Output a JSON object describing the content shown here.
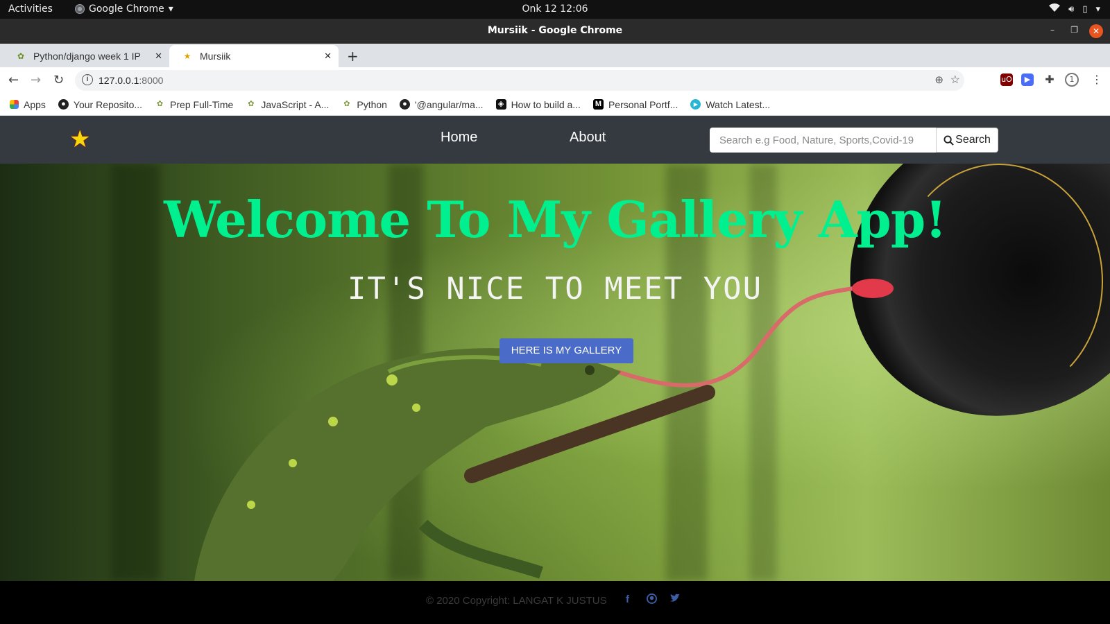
{
  "system": {
    "activities": "Activities",
    "app_name": "Google Chrome",
    "clock": "Onk 12  12:06"
  },
  "window": {
    "title": "Mursiik - Google Chrome"
  },
  "tabs": [
    {
      "label": "Python/django week 1 IP",
      "active": false
    },
    {
      "label": "Mursiik",
      "active": true
    }
  ],
  "address": {
    "host": "127.0.0.1",
    "port": ":8000"
  },
  "bookmarks": [
    {
      "label": "Apps",
      "icon": "apps-grid-icon"
    },
    {
      "label": "Your Reposito...",
      "icon": "github-icon"
    },
    {
      "label": "Prep Full-Time",
      "icon": "leaf-icon"
    },
    {
      "label": "JavaScript - A...",
      "icon": "leaf-icon"
    },
    {
      "label": "Python",
      "icon": "leaf-icon"
    },
    {
      "label": "'@angular/ma...",
      "icon": "github-icon"
    },
    {
      "label": "How to build a...",
      "icon": "dark-icon"
    },
    {
      "label": "Personal Portf...",
      "icon": "medium-icon"
    },
    {
      "label": "Watch Latest...",
      "icon": "play-icon"
    }
  ],
  "site": {
    "nav": {
      "home": "Home",
      "about": "About"
    },
    "search": {
      "placeholder": "Search e.g Food, Nature, Sports,Covid-19",
      "button": "Search"
    },
    "hero": {
      "heading": "Welcome To My Gallery App!",
      "subheading": "IT'S NICE TO MEET YOU",
      "button": "HERE IS MY GALLERY"
    },
    "footer": {
      "copyright": "© 2020 Copyright: LANGAT K JUSTUS",
      "social": [
        "facebook-icon",
        "github-icon",
        "twitter-icon"
      ]
    }
  },
  "colors": {
    "heading": "#00f090",
    "navbar": "#343a40",
    "button": "#4a6bc7",
    "social": "#3b5ea8"
  }
}
